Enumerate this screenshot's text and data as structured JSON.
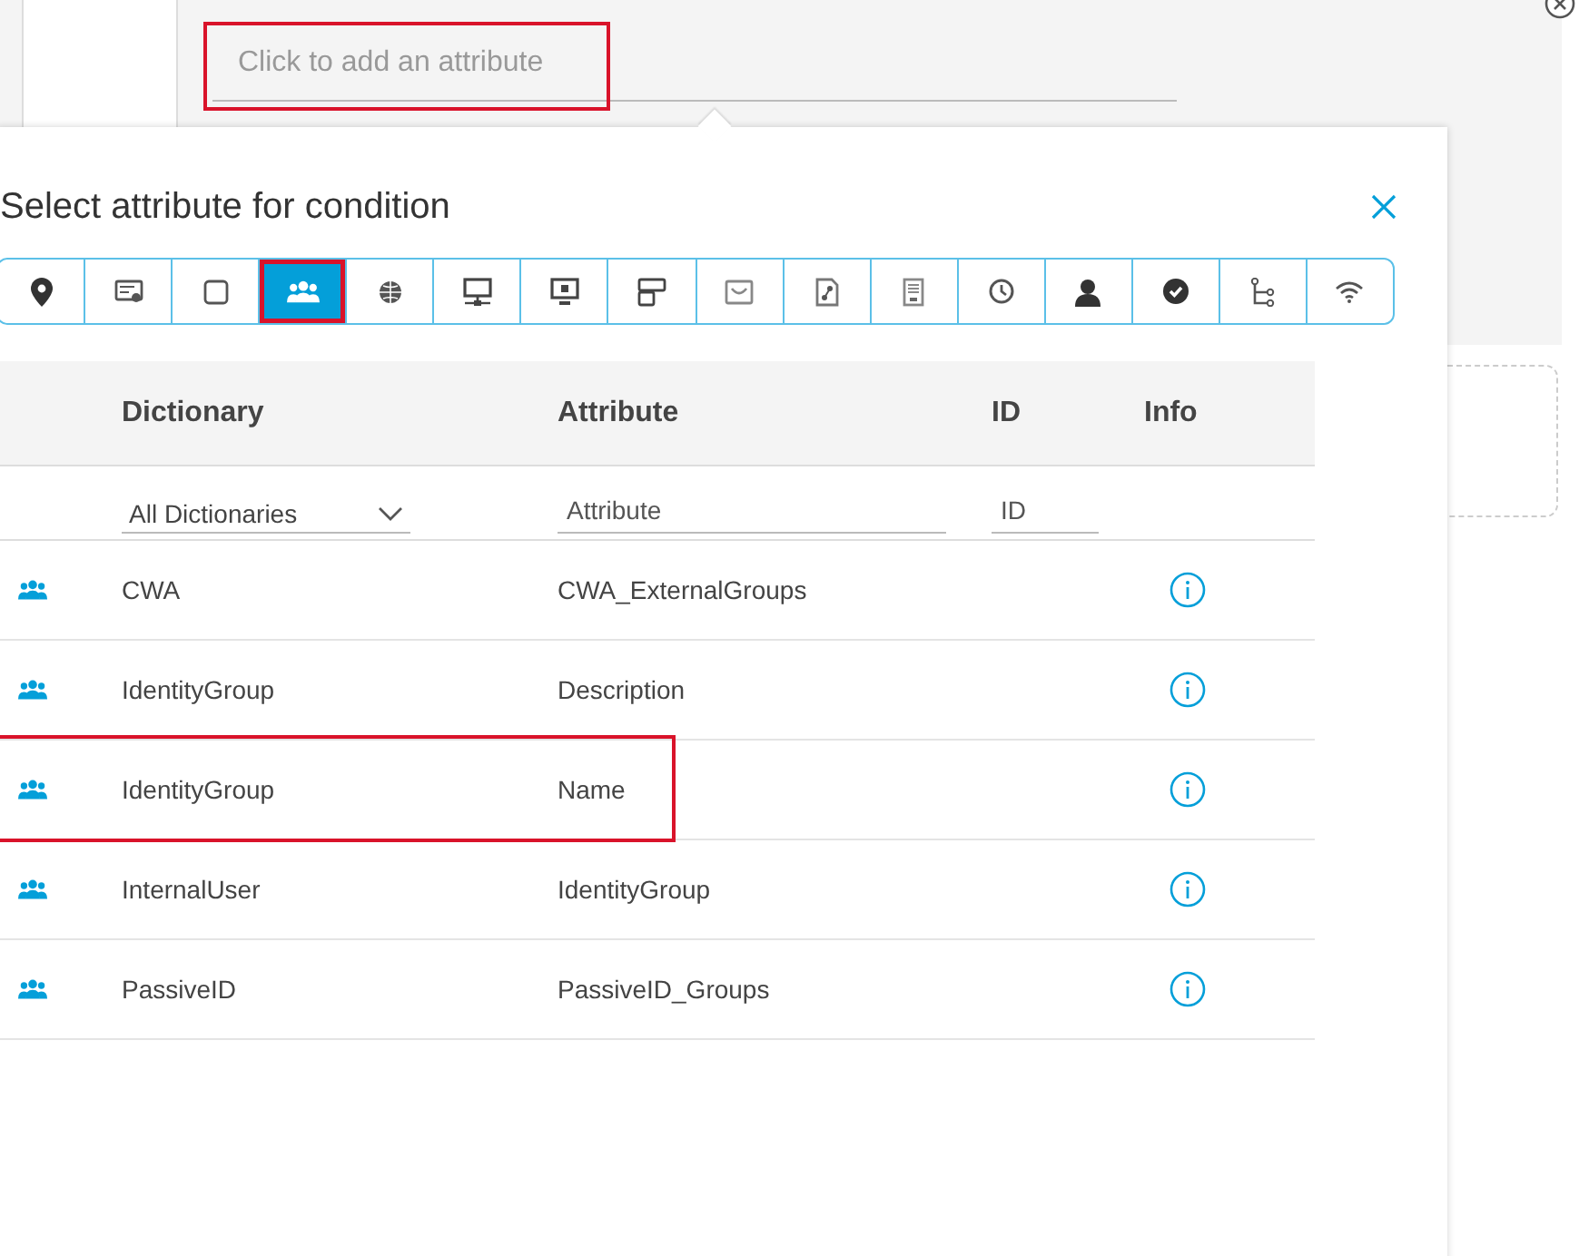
{
  "condition_editor": {
    "attribute_field": {
      "placeholder": "Click to add an attribute",
      "highlighted": true
    }
  },
  "dialog": {
    "title": "Select attribute for condition",
    "toolbar": [
      {
        "kind": "pin",
        "selected": false,
        "highlighted": false
      },
      {
        "kind": "certificate",
        "selected": false,
        "highlighted": false
      },
      {
        "kind": "square",
        "selected": false,
        "highlighted": false
      },
      {
        "kind": "group",
        "selected": true,
        "highlighted": true
      },
      {
        "kind": "globe",
        "selected": false,
        "highlighted": false
      },
      {
        "kind": "network",
        "selected": false,
        "highlighted": false
      },
      {
        "kind": "monitor",
        "selected": false,
        "highlighted": false
      },
      {
        "kind": "device",
        "selected": false,
        "highlighted": false
      },
      {
        "kind": "tray",
        "selected": false,
        "highlighted": false
      },
      {
        "kind": "document",
        "selected": false,
        "highlighted": false
      },
      {
        "kind": "server",
        "selected": false,
        "highlighted": false
      },
      {
        "kind": "clock",
        "selected": false,
        "highlighted": false
      },
      {
        "kind": "person",
        "selected": false,
        "highlighted": false
      },
      {
        "kind": "check",
        "selected": false,
        "highlighted": false
      },
      {
        "kind": "tree",
        "selected": false,
        "highlighted": false
      },
      {
        "kind": "wifi",
        "selected": false,
        "highlighted": false
      }
    ],
    "table": {
      "columns": [
        "Dictionary",
        "Attribute",
        "ID",
        "Info"
      ],
      "filters": {
        "dictionary": "All Dictionaries",
        "attribute_placeholder": "Attribute",
        "id_placeholder": "ID"
      },
      "rows": [
        {
          "dictionary": "CWA",
          "attribute": "CWA_ExternalGroups",
          "highlighted": false
        },
        {
          "dictionary": "IdentityGroup",
          "attribute": "Description",
          "highlighted": false
        },
        {
          "dictionary": "IdentityGroup",
          "attribute": "Name",
          "highlighted": true
        },
        {
          "dictionary": "InternalUser",
          "attribute": "IdentityGroup",
          "highlighted": false
        },
        {
          "dictionary": "PassiveID",
          "attribute": "PassiveID_Groups",
          "highlighted": false
        }
      ]
    }
  }
}
